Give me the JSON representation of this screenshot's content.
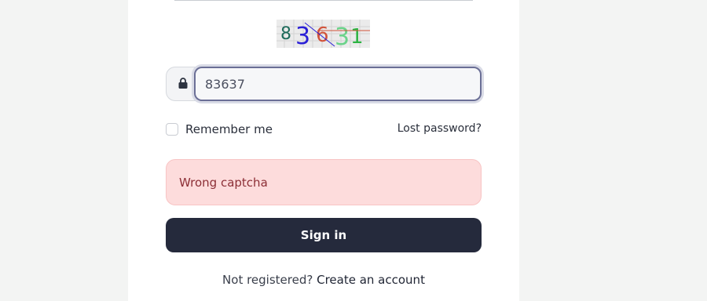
{
  "login": {
    "captcha_input_value": "83637",
    "remember_label": "Remember me",
    "lost_password_label": "Lost password?",
    "error_message": "Wrong captcha",
    "signin_label": "Sign in",
    "not_registered_text": "Not registered?",
    "create_account_label": "Create an account"
  },
  "captcha_image": {
    "digits": [
      {
        "char": "8",
        "color": "#1e6b5b"
      },
      {
        "char": "3",
        "color": "#2a1fd6"
      },
      {
        "char": "6",
        "color": "#d2533a"
      },
      {
        "char": "3",
        "color": "#6bd38a"
      },
      {
        "char": "1",
        "color": "#2db443"
      }
    ]
  },
  "icons": {
    "lock": "lock-icon"
  },
  "colors": {
    "accent_dark": "#252a3c",
    "error_bg": "#fddcdc",
    "error_text": "#8c2f36"
  }
}
